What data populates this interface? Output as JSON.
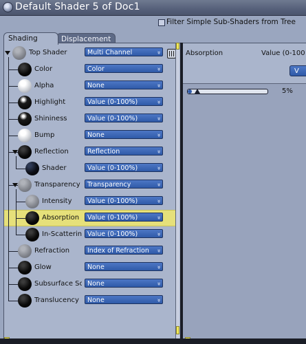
{
  "window": {
    "title": "Default Shader 5 of Doc1",
    "title_icon": "shader-ball-icon"
  },
  "filter": {
    "label": "Filter Simple Sub-Shaders from Tree",
    "checked": false
  },
  "tabs": [
    {
      "label": "Shading",
      "active": true
    },
    {
      "label": "Displacement",
      "active": false
    }
  ],
  "tree": {
    "top": {
      "label": "Top Shader",
      "value": "Multi Channel",
      "ball": "grey",
      "trash_icon": "trash-icon"
    },
    "rows": [
      {
        "label": "Color",
        "value": "Color",
        "ball": "black",
        "indent": 1
      },
      {
        "label": "Alpha",
        "value": "None",
        "ball": "white",
        "indent": 1
      },
      {
        "label": "Highlight",
        "value": "Value (0-100%)",
        "ball": "highlight",
        "indent": 1
      },
      {
        "label": "Shininess",
        "value": "Value (0-100%)",
        "ball": "highlight",
        "indent": 1
      },
      {
        "label": "Bump",
        "value": "None",
        "ball": "white",
        "indent": 1
      },
      {
        "label": "Reflection",
        "value": "Reflection",
        "ball": "black",
        "indent": 1,
        "expanded": true
      },
      {
        "label": "Shader",
        "value": "Value (0-100%)",
        "ball": "shader",
        "indent": 2
      },
      {
        "label": "Transparency",
        "value": "Transparency",
        "ball": "grey",
        "indent": 1,
        "expanded": true
      },
      {
        "label": "Intensity",
        "value": "Value (0-100%)",
        "ball": "grey",
        "indent": 2
      },
      {
        "label": "Absorption",
        "value": "Value (0-100%)",
        "ball": "black",
        "indent": 2,
        "selected": true
      },
      {
        "label": "In-Scattering",
        "value": "Value (0-100%)",
        "ball": "black",
        "indent": 2
      },
      {
        "label": "Refraction",
        "value": "Index of Refraction",
        "ball": "grey",
        "indent": 1
      },
      {
        "label": "Glow",
        "value": "None",
        "ball": "black",
        "indent": 1
      },
      {
        "label": "Subsurface Sc",
        "value": "None",
        "ball": "black",
        "indent": 1
      },
      {
        "label": "Translucency",
        "value": "None",
        "ball": "black",
        "indent": 1
      }
    ]
  },
  "detail": {
    "title": "Absorption",
    "value_type": "Value (0-100",
    "button_label": "V",
    "slider": {
      "value": 5,
      "display": "5%"
    }
  },
  "colors": {
    "selection": "#e6e07a",
    "popup": "#2f5aa8",
    "panel": "#aab5cc"
  }
}
